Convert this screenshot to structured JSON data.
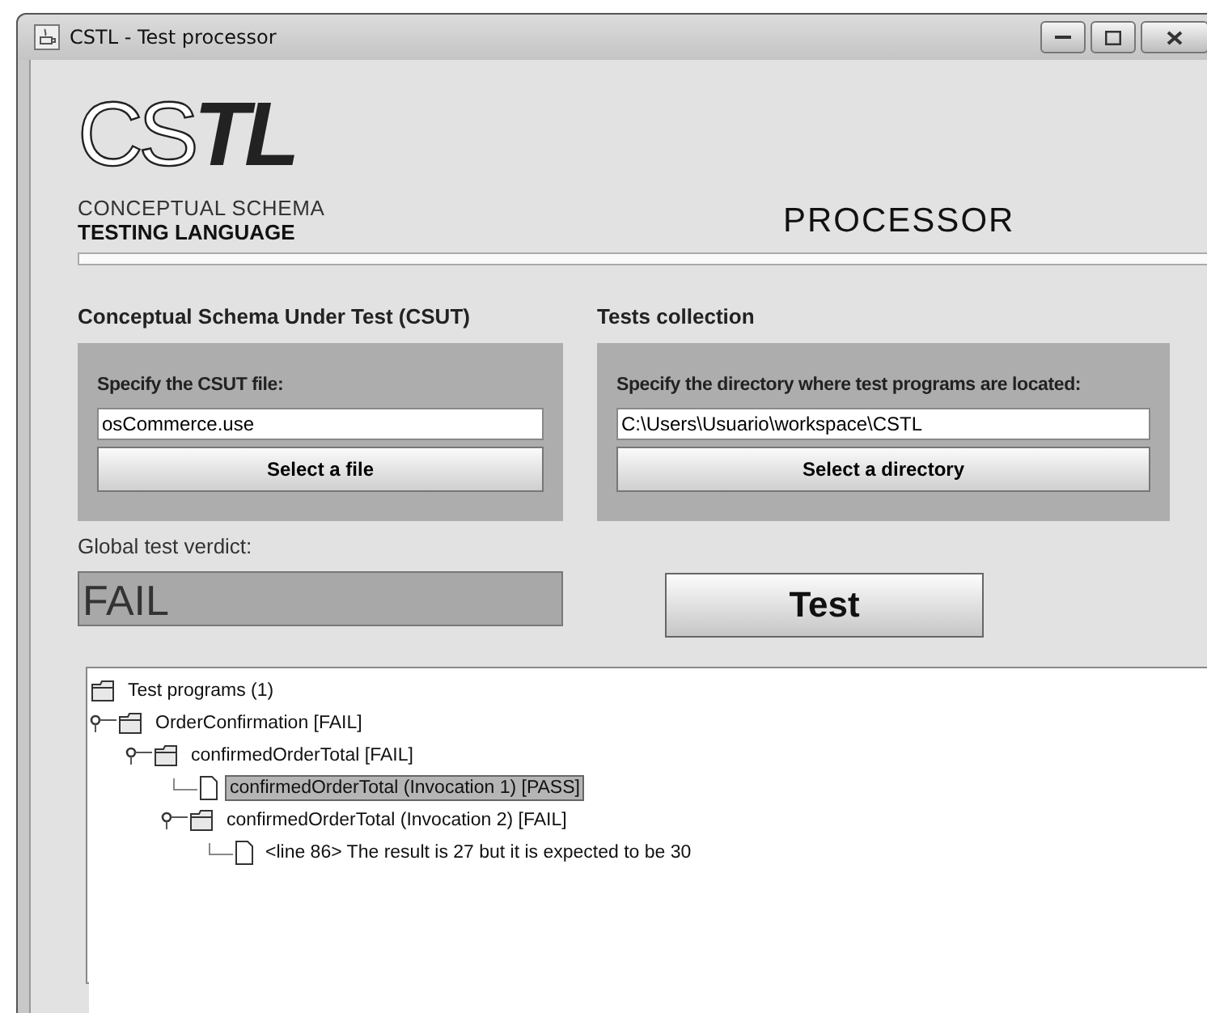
{
  "window": {
    "title": "CSTL - Test processor"
  },
  "logo": {
    "light": "CS",
    "bold": "TL",
    "line1": "CONCEPTUAL SCHEMA",
    "line2": "TESTING LANGUAGE"
  },
  "heading": "PROCESSOR",
  "progress": {
    "level": 1
  },
  "sections": [
    {
      "title": "Conceptual Schema Under Test (CSUT)",
      "label": "Specify the CSUT file:",
      "value": "osCommerce.use",
      "button": "Select a file"
    },
    {
      "title": "Tests collection",
      "label": "Specify the directory where test programs are located:",
      "value": "C:\\Users\\Usuario\\workspace\\CSTL",
      "button": "Select a directory"
    }
  ],
  "verdict": {
    "label": "Global test verdict:",
    "value": "FAIL"
  },
  "test_button": "Test",
  "tree": {
    "label": "Test programs (1)",
    "kind": "folder",
    "selected": false,
    "children": [
      {
        "label": "OrderConfirmation [FAIL]",
        "kind": "folder",
        "expanded": true,
        "selected": false,
        "children": [
          {
            "label": "confirmedOrderTotal [FAIL]",
            "kind": "folder",
            "expanded": true,
            "selected": false,
            "children": [
              {
                "label": "confirmedOrderTotal (Invocation 1) [PASS]",
                "kind": "file",
                "selected": true
              },
              {
                "label": "confirmedOrderTotal (Invocation 2) [FAIL]",
                "kind": "folder",
                "expanded": true,
                "selected": false,
                "children": [
                  {
                    "label": "<line 86> The result is 27 but it is expected to be 30",
                    "kind": "file",
                    "selected": false
                  }
                ]
              }
            ]
          }
        ]
      }
    ]
  }
}
